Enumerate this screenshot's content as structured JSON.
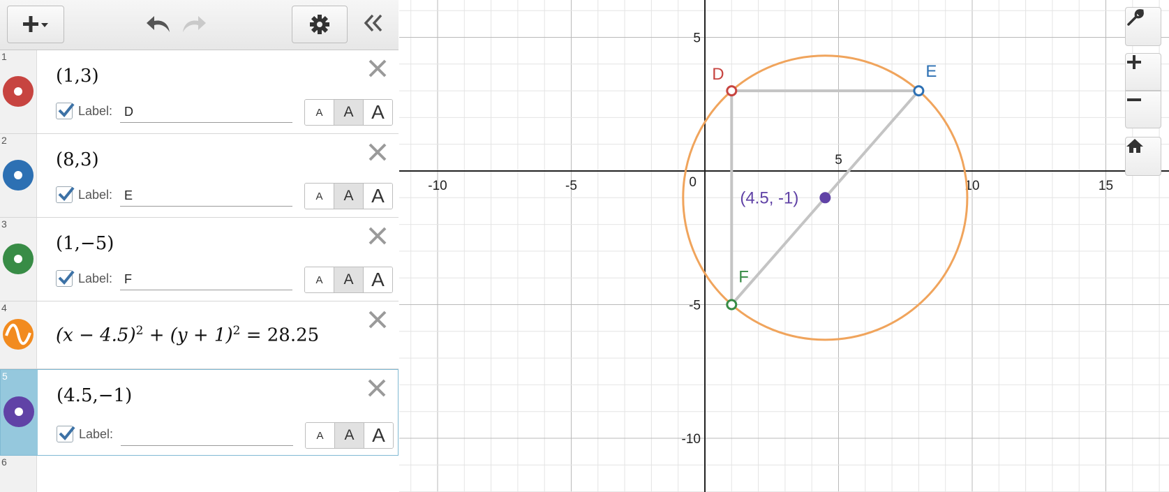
{
  "expressions": [
    {
      "index": "1",
      "math": "(1,3)",
      "label_text": "Label:",
      "label_value": "D",
      "size_labels": [
        "A",
        "A",
        "A"
      ],
      "color": "#c74440"
    },
    {
      "index": "2",
      "math": "(8,3)",
      "label_text": "Label:",
      "label_value": "E",
      "size_labels": [
        "A",
        "A",
        "A"
      ],
      "color": "#2d70b3"
    },
    {
      "index": "3",
      "math": "(1,−5)",
      "label_text": "Label:",
      "label_value": "F",
      "size_labels": [
        "A",
        "A",
        "A"
      ],
      "color": "#388c46"
    },
    {
      "index": "4",
      "math_parts": [
        "(x − 4.5)",
        "2",
        " + (y + 1)",
        "2",
        " = 28.25"
      ],
      "color": "#fa7e19"
    },
    {
      "index": "5",
      "math": "(4.5,−1)",
      "label_text": "Label:",
      "label_value": "",
      "size_labels": [
        "A",
        "A",
        "A"
      ],
      "color": "#6042a6"
    },
    {
      "index": "6"
    }
  ],
  "graph": {
    "x_ticks": [
      "-10",
      "-5",
      "0",
      "5",
      "10",
      "15"
    ],
    "y_ticks": [
      "5",
      "-5",
      "-10"
    ],
    "point_labels": {
      "D": "D",
      "E": "E",
      "F": "F",
      "center": "(4.5, -1)"
    },
    "points": [
      {
        "name": "D",
        "x": 1,
        "y": 3,
        "color": "#c74440"
      },
      {
        "name": "E",
        "x": 8,
        "y": 3,
        "color": "#2d70b3"
      },
      {
        "name": "F",
        "x": 1,
        "y": -5,
        "color": "#388c46"
      },
      {
        "name": "center",
        "x": 4.5,
        "y": -1,
        "color": "#6042a6"
      }
    ],
    "circle": {
      "cx": 4.5,
      "cy": -1,
      "r2": 28.25,
      "color": "#f0a45c"
    },
    "segment_color": "#c4c4c4"
  },
  "toolbar": {
    "icons": [
      "add-expression-icon",
      "undo-icon",
      "redo-icon",
      "settings-gear-icon",
      "collapse-panel-icon"
    ]
  },
  "side_controls": [
    "wrench-icon",
    "zoom-in-icon",
    "zoom-out-icon",
    "home-icon"
  ]
}
